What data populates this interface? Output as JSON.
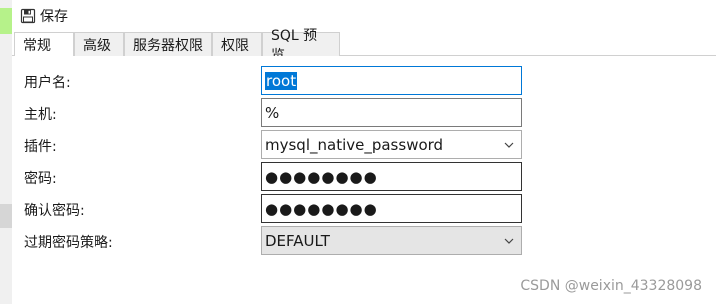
{
  "toolbar": {
    "save_label": "保存",
    "save_icon": "save-icon"
  },
  "tabs": [
    {
      "label": "常规",
      "active": true
    },
    {
      "label": "高级",
      "active": false
    },
    {
      "label": "服务器权限",
      "active": false
    },
    {
      "label": "权限",
      "active": false
    },
    {
      "label": "SQL 预览",
      "active": false
    }
  ],
  "form": {
    "username": {
      "label": "用户名:",
      "value": "root"
    },
    "host": {
      "label": "主机:",
      "value": "%"
    },
    "plugin": {
      "label": "插件:",
      "value": "mysql_native_password"
    },
    "password": {
      "label": "密码:",
      "value": "●●●●●●●●"
    },
    "confirm_password": {
      "label": "确认密码:",
      "value": "●●●●●●●●"
    },
    "password_expiry": {
      "label": "过期密码策略:",
      "value": "DEFAULT"
    }
  },
  "watermark": "CSDN @weixin_43328098",
  "colors": {
    "accent": "#0078d7",
    "edge_green": "#b6f28a"
  }
}
